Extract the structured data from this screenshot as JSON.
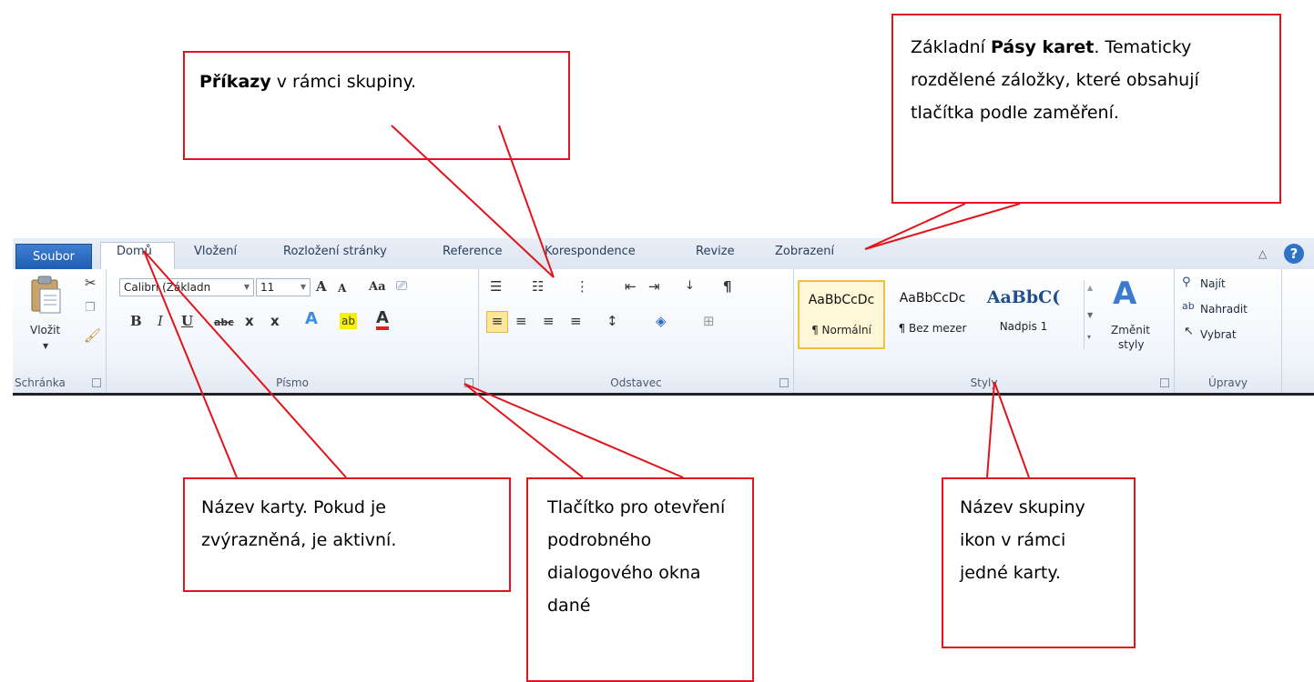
{
  "callouts": {
    "top_left": {
      "bold": "Příkazy",
      "text": " v rámci skupiny."
    },
    "top_right": {
      "pre": "Základní ",
      "bold": "Pásy karet",
      "text": ". Tematicky rozdělené záložky, které obsahují tlačítka podle zaměření."
    },
    "bottom_tab": {
      "text": "Název karty. Pokud je zvýrazněná, je aktivní."
    },
    "bottom_launcher": {
      "text": "Tlačítko pro otevření podrobného dialogového okna dané"
    },
    "bottom_group": {
      "text": "Název skupiny ikon v rámci jedné karty."
    },
    "line_color": "#e0141a"
  },
  "ribbon": {
    "tabs": {
      "file": "Soubor",
      "home": "Domů",
      "insert": "Vložení",
      "layout": "Rozložení stránky",
      "references": "Reference",
      "mailings": "Korespondence",
      "review": "Revize",
      "view": "Zobrazení"
    },
    "clipboard": {
      "label": "Schránka",
      "paste": "Vložit"
    },
    "font": {
      "label": "Písmo",
      "font_name": "Calibri (Základn",
      "font_size": "11",
      "change_case": "Aa",
      "grow": "A",
      "shrink": "A",
      "bold": "B",
      "italic": "I",
      "underline": "U",
      "strike": "abc",
      "subscript": "x",
      "superscript": "x",
      "font_color": "A"
    },
    "paragraph": {
      "label": "Odstavec",
      "pilcrow": "¶"
    },
    "styles": {
      "label": "Styly",
      "items": [
        {
          "sample": "AaBbCcDc",
          "name": "¶ Normální"
        },
        {
          "sample": "AaBbCcDc",
          "name": "¶ Bez mezer"
        },
        {
          "sample": "AaBbC(",
          "name": "Nadpis 1"
        }
      ],
      "change_styles_1": "Změnit",
      "change_styles_2": "styly"
    },
    "editing": {
      "label": "Úpravy",
      "find": "Najít",
      "replace": "Nahradit",
      "select": "Vybrat"
    }
  }
}
